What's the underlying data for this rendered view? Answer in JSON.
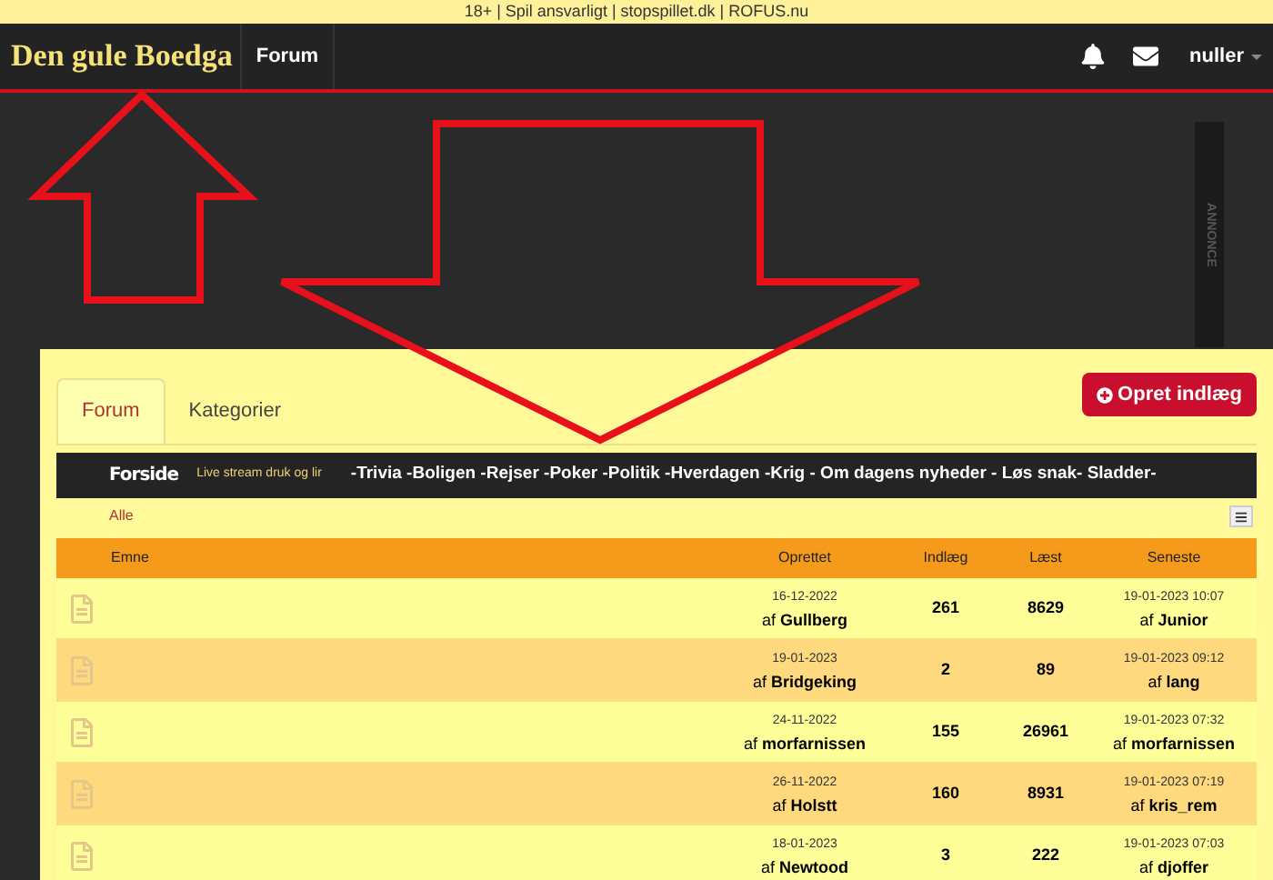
{
  "top_notice": "18+ | Spil ansvarligt | stopspillet.dk | ROFUS.nu",
  "header": {
    "logo": "Den gule Boedga",
    "nav": [
      "Forum"
    ],
    "user": "nuller"
  },
  "ad_label": "ANNONCE",
  "tabs": [
    {
      "label": "Forum",
      "selected": true
    },
    {
      "label": "Kategorier",
      "selected": false
    }
  ],
  "create_button": "Opret indlæg",
  "category_bar": {
    "home": "Forside",
    "live": "Live  stream druk og lir",
    "categories": "-Trivia  -Boligen  -Rejser -Poker -Politik -Hverdagen -Krig - Om dagens nyheder - Løs snak- Sladder-"
  },
  "filter": "Alle",
  "table": {
    "columns": [
      "Emne",
      "Oprettet",
      "Indlæg",
      "Læst",
      "Seneste"
    ],
    "rows": [
      {
        "created": "16-12-2022",
        "author": "af **Gullberg**",
        "posts": "261",
        "views": "8629",
        "latest": "19-01-2023 10:07",
        "latest_author": "af **Junior**"
      },
      {
        "created": "19-01-2023",
        "author": "af **Bridgeking**",
        "posts": "2",
        "views": "89",
        "latest": "19-01-2023 09:12",
        "latest_author": "af **lang**"
      },
      {
        "created": "24-11-2022",
        "author": "af **morfarnissen**",
        "posts": "155",
        "views": "26961",
        "latest": "19-01-2023 07:32",
        "latest_author": "af **morfarnissen**"
      },
      {
        "created": "26-11-2022",
        "author": "af **Holstt**",
        "posts": "160",
        "views": "8931",
        "latest": "19-01-2023 07:19",
        "latest_author": "af **kris_rem**"
      },
      {
        "created": "18-01-2023",
        "author": "af **Newtood**",
        "posts": "3",
        "views": "222",
        "latest": "19-01-2023 07:03",
        "latest_author": "af **djoffer**"
      }
    ]
  }
}
